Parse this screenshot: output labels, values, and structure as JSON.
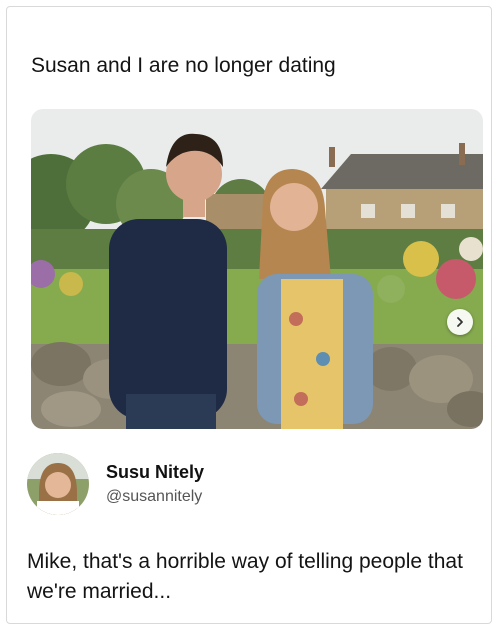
{
  "post": {
    "text": "Susan and I are no longer dating",
    "photo_alt_icon": "image-photo-couple",
    "next_icon": "chevron-right-icon"
  },
  "reply": {
    "display_name": "Susu Nitely",
    "handle": "@susannitely",
    "text": "Mike, that's a horrible way of telling people that we're married..."
  },
  "colors": {
    "text": "#141414",
    "handle": "#555555",
    "border": "#d9d9d9"
  }
}
